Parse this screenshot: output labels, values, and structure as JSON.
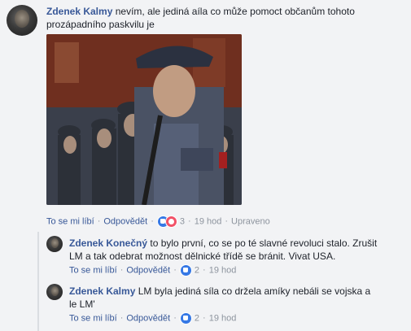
{
  "comment": {
    "author": "Zdenek Kalmy",
    "text_line1": "nevím, ale jediná aíla co může pomoct občanům tohoto",
    "text_line2": "prozápadního paskvilu je",
    "actions": {
      "like": "To se mi líbí",
      "reply": "Odpovědět",
      "reaction_count": "3",
      "time": "19 hod",
      "edited": "Upraveno"
    }
  },
  "replies": [
    {
      "author": "Zdenek Konečný",
      "text_line1": "to bylo první, co se po té slavné revoluci stalo. Zrušit",
      "text_line2": "LM a tak odebrat možnost dělnické třídě se bránit. Vivat USA.",
      "actions": {
        "like": "To se mi líbí",
        "reply": "Odpovědět",
        "reaction_count": "2",
        "time": "19 hod"
      }
    },
    {
      "author": "Zdenek Kalmy",
      "text_line1": "LM byla jediná síla co držela amíky nebáli se vojska a",
      "text_line2": "le LM'",
      "actions": {
        "like": "To se mi líbí",
        "reply": "Odpovědět",
        "reaction_count": "2",
        "time": "19 hod"
      }
    }
  ],
  "colors": {
    "link": "#385898",
    "background": "#f2f3f5",
    "like": "#3578e5",
    "angry": "#f25268"
  },
  "icons": [
    "like-reaction-icon",
    "angry-reaction-icon"
  ]
}
